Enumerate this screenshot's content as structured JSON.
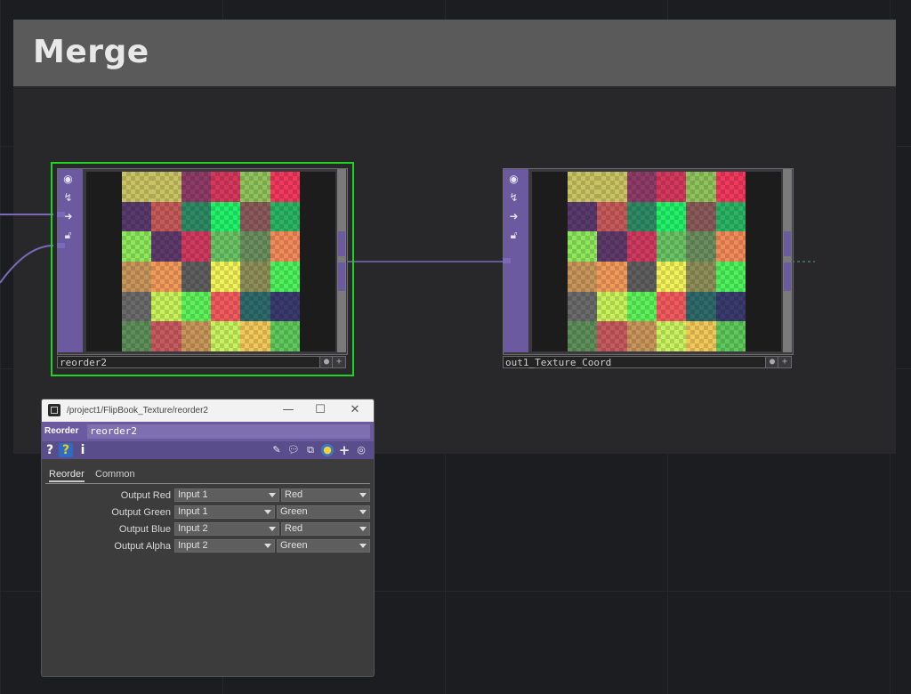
{
  "network": {
    "comment_title": "Merge",
    "nodes": [
      {
        "name": "reorder2",
        "selected": true
      },
      {
        "name": "out1_Texture_Coord",
        "selected": false
      }
    ],
    "tile_colors": [
      "#c8c464",
      "#c8c464",
      "#8f3b68",
      "#d6375c",
      "#8fc45c",
      "#f2385c",
      "#5a3a6e",
      "#c65a5a",
      "#2e8a64",
      "#22f26a",
      "#8a5a5a",
      "#2ab464",
      "#8ee85c",
      "#5e3a6a",
      "#d03a60",
      "#6ac464",
      "#6a8e5e",
      "#f28a5a",
      "#c8965a",
      "#f29a5a",
      "#5e5e5e",
      "#f2f25a",
      "#8e8e5a",
      "#4ef25c",
      "#6a6a6a",
      "#c8f25a",
      "#5ef25a",
      "#f25a5e",
      "#2e6a6a",
      "#3a3a6e",
      "#5e8e5a",
      "#c65a5e",
      "#c8965a",
      "#c8f25e",
      "#f2c85a",
      "#5ec85a"
    ]
  },
  "dialog": {
    "title": "/project1/FlipBook_Texture/reorder2",
    "minimize_glyph": "—",
    "maximize_glyph": "☐",
    "close_glyph": "✕",
    "op_type": "Reorder",
    "op_name": "reorder2",
    "help_glyph": "?",
    "help_icon_glyph": "?",
    "info_glyph": "i",
    "tabs": [
      "Reorder",
      "Common"
    ],
    "params": [
      {
        "label": "Output Red",
        "input": "Input 1",
        "channel": "Red"
      },
      {
        "label": "Output Green",
        "input": "Input 1",
        "channel": "Green"
      },
      {
        "label": "Output Blue",
        "input": "Input 2",
        "channel": "Red"
      },
      {
        "label": "Output Alpha",
        "input": "Input 2",
        "channel": "Green"
      }
    ]
  },
  "colors": {
    "operator_purple": "#6c5aa0",
    "selection_green": "#22d422",
    "wire": "#7a6ab8"
  }
}
